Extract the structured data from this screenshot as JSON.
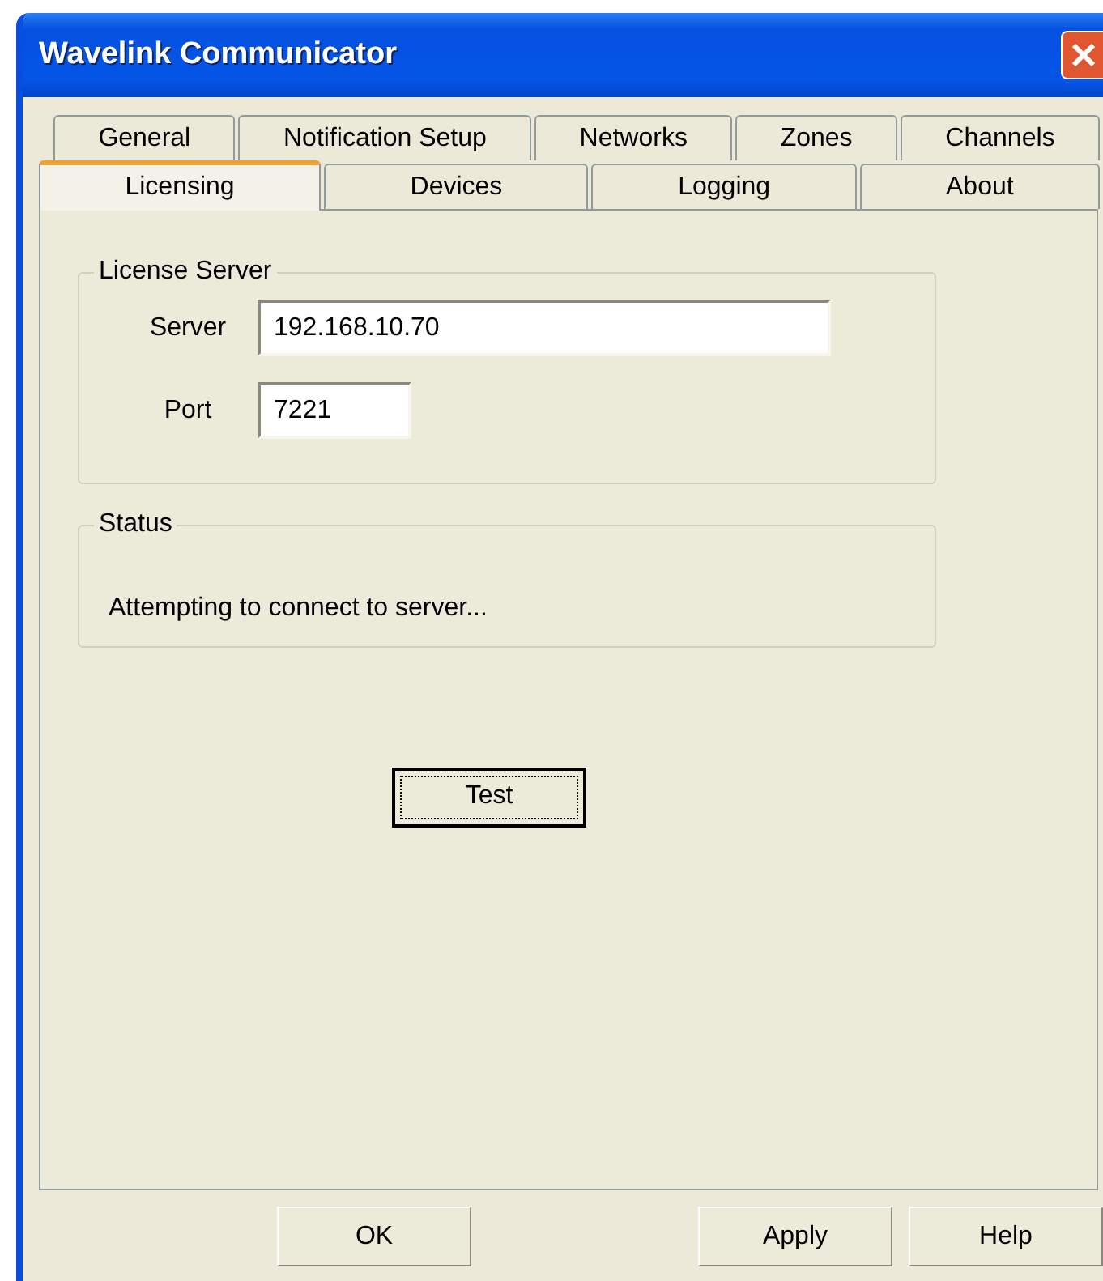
{
  "window": {
    "title": "Wavelink Communicator"
  },
  "tab_rows": [
    [
      {
        "label": "General",
        "selected": false
      },
      {
        "label": "Notification Setup",
        "selected": false
      },
      {
        "label": "Networks",
        "selected": false
      },
      {
        "label": "Zones",
        "selected": false
      },
      {
        "label": "Channels",
        "selected": false
      }
    ],
    [
      {
        "label": "Licensing",
        "selected": true
      },
      {
        "label": "Devices",
        "selected": false
      },
      {
        "label": "Logging",
        "selected": false
      },
      {
        "label": "About",
        "selected": false
      }
    ]
  ],
  "license_server": {
    "title": "License Server",
    "fields": [
      {
        "label": "Server",
        "value": "192.168.10.70",
        "kind": "wide"
      },
      {
        "label": "Port",
        "value": "7221",
        "kind": "narrow"
      }
    ]
  },
  "status": {
    "title": "Status",
    "text": "Attempting to connect to server..."
  },
  "test_button": {
    "label": "Test",
    "focused": true
  },
  "buttons": [
    "OK",
    "Apply",
    "Help"
  ]
}
